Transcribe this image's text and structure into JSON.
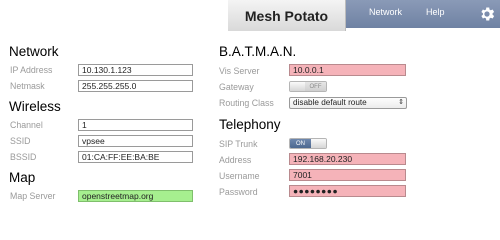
{
  "header": {
    "title": "Mesh Potato",
    "nav": {
      "network": "Network",
      "help": "Help"
    },
    "settings_icon": "gear-icon",
    "colors": {
      "topbar": "#7586a5",
      "tab": "#e4e4e4"
    }
  },
  "network": {
    "heading": "Network",
    "ip_label": "IP Address",
    "ip_value": "10.130.1.123",
    "netmask_label": "Netmask",
    "netmask_value": "255.255.255.0"
  },
  "wireless": {
    "heading": "Wireless",
    "channel_label": "Channel",
    "channel_value": "1",
    "ssid_label": "SSID",
    "ssid_value": "vpsee",
    "bssid_label": "BSSID",
    "bssid_value": "01:CA:FF:EE:BA:BE"
  },
  "map": {
    "heading": "Map",
    "server_label": "Map Server",
    "server_value": "openstreetmap.org"
  },
  "batman": {
    "heading": "B.A.T.M.A.N.",
    "vis_label": "Vis Server",
    "vis_value": "10.0.0.1",
    "gateway_label": "Gateway",
    "gateway_state": "OFF",
    "routing_label": "Routing Class",
    "routing_value": "disable default route"
  },
  "telephony": {
    "heading": "Telephony",
    "sip_label": "SIP Trunk",
    "sip_state": "ON",
    "address_label": "Address",
    "address_value": "192.168.20.230",
    "username_label": "Username",
    "username_value": "7001",
    "password_label": "Password",
    "password_value": "●●●●●●●●"
  },
  "colors": {
    "invalid_field": "#f5b3b9",
    "valid_field": "#a6ef8f",
    "toggle_on": "#5c77a0"
  }
}
